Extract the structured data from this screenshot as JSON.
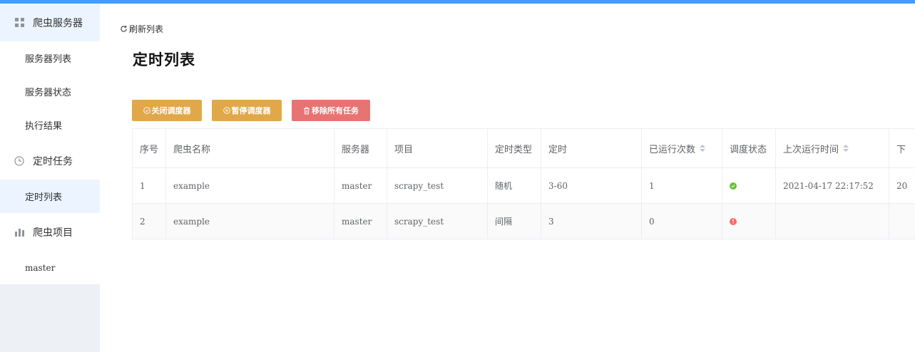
{
  "sidebar": {
    "groups": [
      {
        "label": "爬虫服务器",
        "icon": "grid-icon",
        "items": [
          "服务器列表",
          "服务器状态",
          "执行结果"
        ]
      },
      {
        "label": "定时任务",
        "icon": "clock-icon",
        "items": [
          "定时列表"
        ]
      },
      {
        "label": "爬虫项目",
        "icon": "bar-chart-icon",
        "items": [
          "master"
        ]
      }
    ],
    "active_item": "定时列表"
  },
  "main": {
    "refresh_label": "刷新列表",
    "title": "定时列表",
    "buttons": {
      "close_scheduler": "关闭调度器",
      "pause_scheduler": "暂停调度器",
      "remove_all": "移除所有任务"
    }
  },
  "table": {
    "headers": [
      "序号",
      "爬虫名称",
      "服务器",
      "项目",
      "定时类型",
      "定时",
      "已运行次数",
      "调度状态",
      "上次运行时间",
      "下"
    ],
    "rows": [
      {
        "index": "1",
        "spider": "example",
        "server": "master",
        "project": "scrapy_test",
        "type": "随机",
        "schedule": "3-60",
        "runs": "1",
        "status": "ok",
        "last_run": "2021-04-17 22:17:52",
        "next": "20"
      },
      {
        "index": "2",
        "spider": "example",
        "server": "master",
        "project": "scrapy_test",
        "type": "间隔",
        "schedule": "3",
        "runs": "0",
        "status": "error",
        "last_run": "",
        "next": ""
      }
    ]
  },
  "colors": {
    "accent": "#409eff",
    "warning": "#e0a849",
    "danger": "#e87373",
    "status_ok": "#67c23a",
    "status_error": "#f56c6c"
  }
}
